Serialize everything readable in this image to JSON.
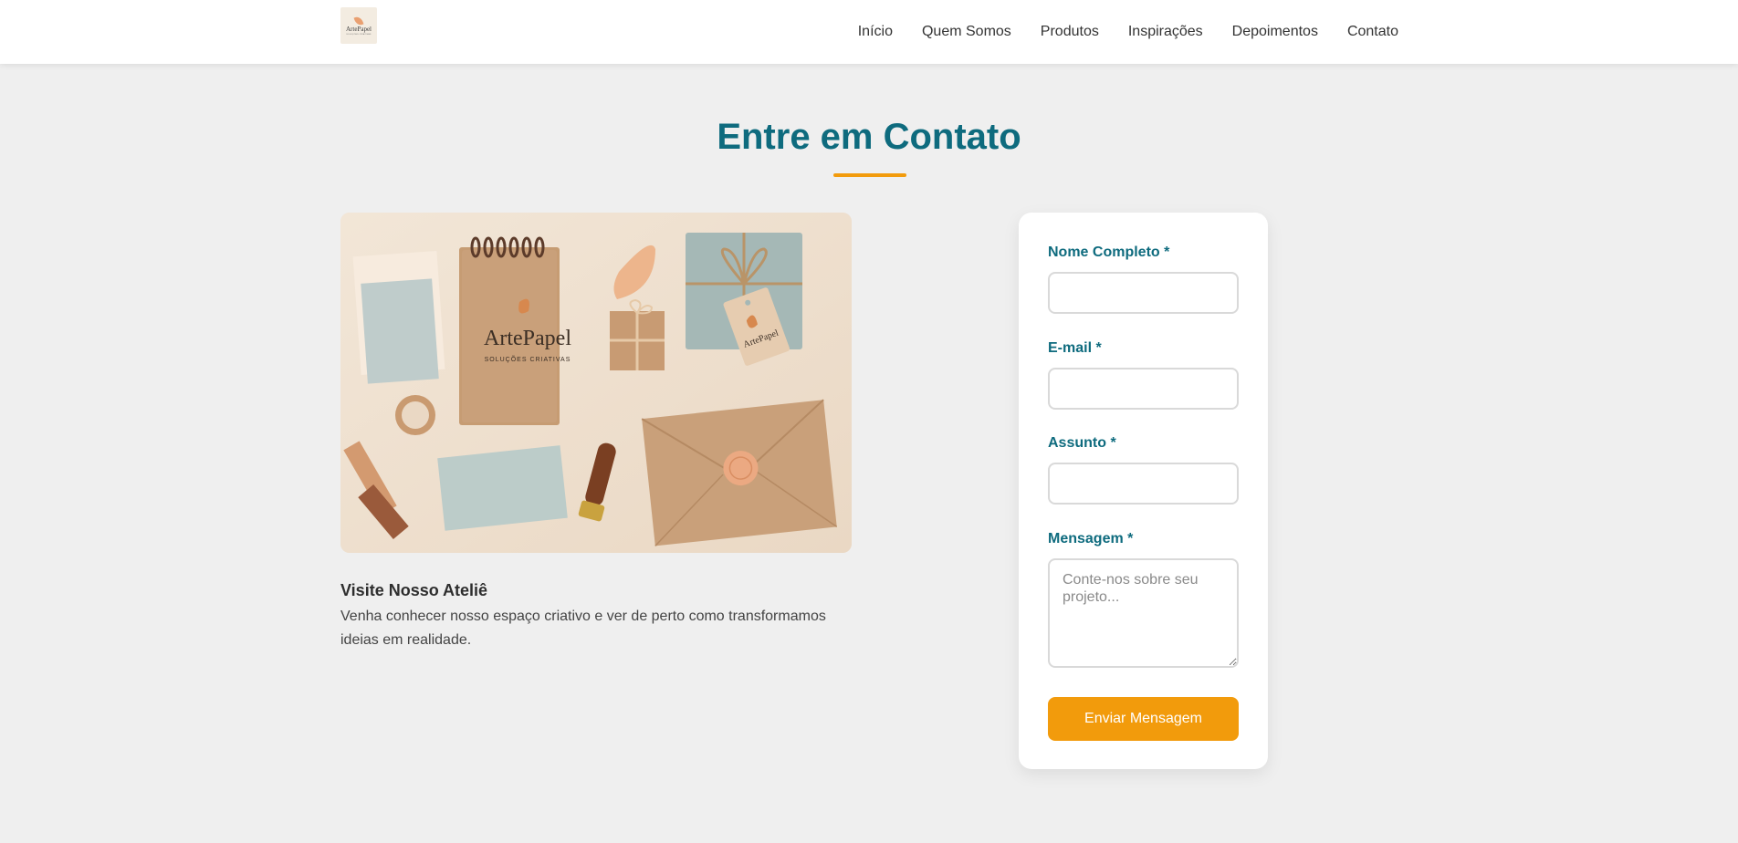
{
  "header": {
    "logo": {
      "brand": "ArtePapel",
      "tagline": "SOLUÇÕES CRIATIVAS"
    },
    "nav": [
      {
        "label": "Início"
      },
      {
        "label": "Quem Somos"
      },
      {
        "label": "Produtos"
      },
      {
        "label": "Inspirações"
      },
      {
        "label": "Depoimentos"
      },
      {
        "label": "Contato"
      }
    ]
  },
  "contact": {
    "title": "Entre em Contato",
    "image": {
      "brand": "ArtePapel",
      "tagline": "SOLUÇÕES CRIATIVAS",
      "tag_text": "ArtePapel"
    },
    "visit_title": "Visite Nosso Ateliê",
    "visit_text": "Venha conhecer nosso espaço criativo e ver de perto como transformamos ideias em realidade.",
    "form": {
      "name_label": "Nome Completo *",
      "name_value": "",
      "email_label": "E-mail *",
      "email_value": "",
      "subject_label": "Assunto *",
      "subject_value": "",
      "message_label": "Mensagem *",
      "message_placeholder": "Conte-nos sobre seu projeto...",
      "message_value": "",
      "submit_label": "Enviar Mensagem"
    }
  },
  "colors": {
    "primary": "#0e6b7e",
    "accent": "#f29b0c",
    "background": "#efefef"
  }
}
